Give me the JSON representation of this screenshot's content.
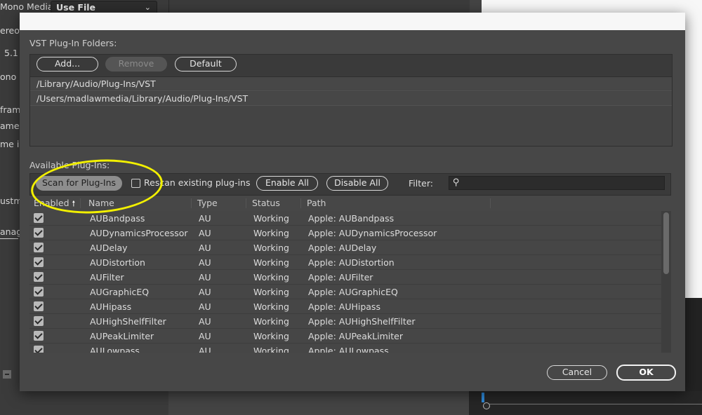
{
  "background": {
    "mono_media_label": "Mono Media:",
    "mono_media_value": "Use File",
    "side_texts": [
      "ereo",
      "5.1",
      "ono",
      "frame",
      "ame",
      "me in",
      "ustm",
      "anag"
    ]
  },
  "dialog": {
    "vst_folders_label": "VST Plug-In Folders:",
    "buttons": {
      "add": "Add...",
      "remove": "Remove",
      "default": "Default"
    },
    "folders": [
      "/Library/Audio/Plug-Ins/VST",
      "/Users/madlawmedia/Library/Audio/Plug-Ins/VST"
    ],
    "available_label": "Available Plug-Ins:",
    "scan_button": "Scan for Plug-Ins",
    "rescan_label": "Rescan existing plug-ins",
    "enable_all": "Enable All",
    "disable_all": "Disable All",
    "filter_label": "Filter:",
    "filter_value": "",
    "columns": {
      "enabled": "Enabled",
      "sort_arrow": "🠕",
      "name": "Name",
      "type": "Type",
      "status": "Status",
      "path": "Path"
    },
    "rows": [
      {
        "enabled": true,
        "name": "AUBandpass",
        "type": "AU",
        "status": "Working",
        "path": "Apple: AUBandpass"
      },
      {
        "enabled": true,
        "name": "AUDynamicsProcessor",
        "type": "AU",
        "status": "Working",
        "path": "Apple: AUDynamicsProcessor"
      },
      {
        "enabled": true,
        "name": "AUDelay",
        "type": "AU",
        "status": "Working",
        "path": "Apple: AUDelay"
      },
      {
        "enabled": true,
        "name": "AUDistortion",
        "type": "AU",
        "status": "Working",
        "path": "Apple: AUDistortion"
      },
      {
        "enabled": true,
        "name": "AUFilter",
        "type": "AU",
        "status": "Working",
        "path": "Apple: AUFilter"
      },
      {
        "enabled": true,
        "name": "AUGraphicEQ",
        "type": "AU",
        "status": "Working",
        "path": "Apple: AUGraphicEQ"
      },
      {
        "enabled": true,
        "name": "AUHipass",
        "type": "AU",
        "status": "Working",
        "path": "Apple: AUHipass"
      },
      {
        "enabled": true,
        "name": "AUHighShelfFilter",
        "type": "AU",
        "status": "Working",
        "path": "Apple: AUHighShelfFilter"
      },
      {
        "enabled": true,
        "name": "AUPeakLimiter",
        "type": "AU",
        "status": "Working",
        "path": "Apple: AUPeakLimiter"
      },
      {
        "enabled": true,
        "name": "AULowpass",
        "type": "AU",
        "status": "Working",
        "path": "Apple: AULowpass"
      }
    ],
    "cancel": "Cancel",
    "ok": "OK"
  },
  "colors": {
    "highlight_ellipse": "#f2f000",
    "dialog_bg": "#474747"
  }
}
